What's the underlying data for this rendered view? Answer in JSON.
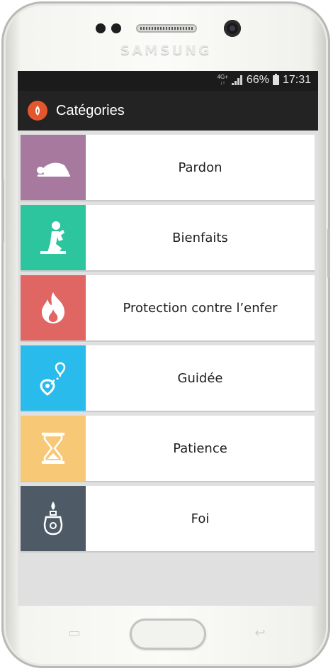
{
  "device": {
    "brand": "SAMSUNG"
  },
  "status_bar": {
    "network": "4G+",
    "battery": "66%",
    "time": "17:31"
  },
  "app_bar": {
    "title": "Catégories",
    "icon": "app-logo-icon"
  },
  "categories": [
    {
      "label": "Pardon",
      "color": "#A8799F",
      "icon": "prostrating-person-icon"
    },
    {
      "label": "Bienfaits",
      "color": "#2DC59E",
      "icon": "kneeling-prayer-icon"
    },
    {
      "label": "Protection contre l’enfer",
      "color": "#E06664",
      "icon": "fire-icon"
    },
    {
      "label": "Guidée",
      "color": "#29BBEC",
      "icon": "route-pin-icon"
    },
    {
      "label": "Patience",
      "color": "#F7C876",
      "icon": "hourglass-icon"
    },
    {
      "label": "Foi",
      "color": "#4E5B66",
      "icon": "lamp-icon"
    }
  ],
  "colors": {
    "status_bar": "#1B1B1B",
    "app_bar": "#232323",
    "accent": "#E4572E",
    "background": "#E0E0E0"
  }
}
